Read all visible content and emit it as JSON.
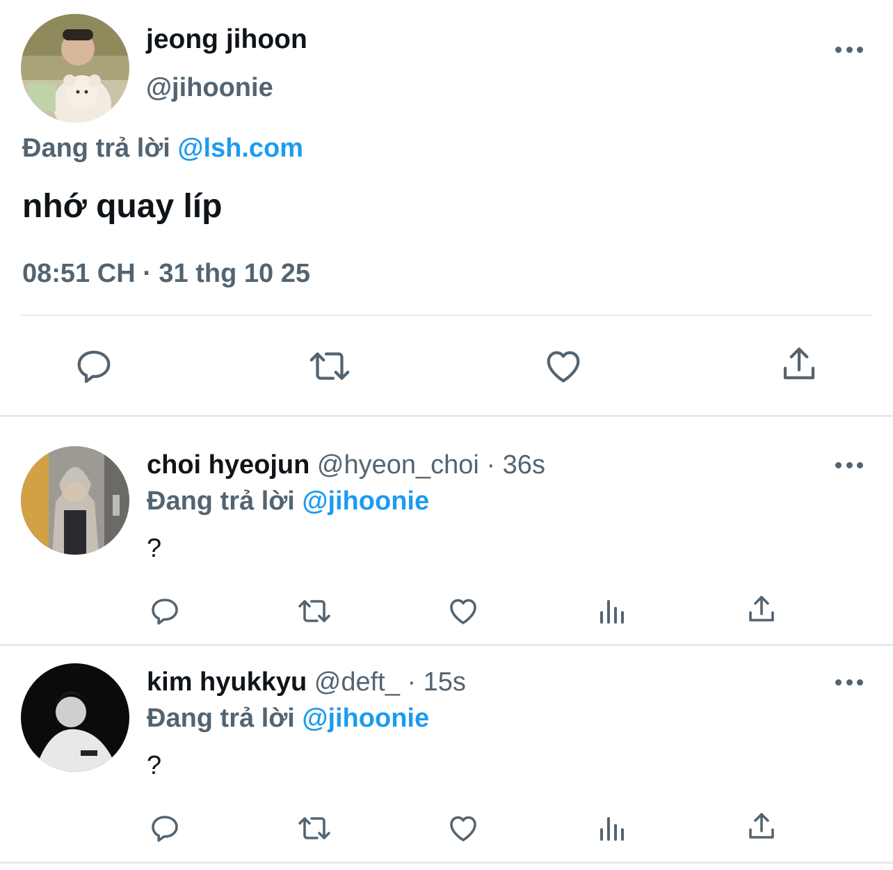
{
  "main_tweet": {
    "display_name": "jeong jihoon",
    "handle": "@jihoonie",
    "replying_prefix": "Đang trả lời",
    "replying_to": "@lsh.com",
    "text": "nhớ quay líp",
    "timestamp": "08:51 CH · 31 thg 10 25",
    "actions": [
      "reply-icon",
      "retweet-icon",
      "like-icon",
      "share-icon"
    ]
  },
  "replies": [
    {
      "display_name": "choi hyeojun",
      "handle": "@hyeon_choi",
      "sep": "·",
      "time": "36s",
      "replying_prefix": "Đang trả lời",
      "replying_to": "@jihoonie",
      "text": "?"
    },
    {
      "display_name": "kim hyukkyu",
      "handle": "@deft_",
      "sep": "·",
      "time": "15s",
      "replying_prefix": "Đang trả lời",
      "replying_to": "@jihoonie",
      "text": "?"
    }
  ],
  "colors": {
    "primary_text": "#0f1419",
    "secondary_text": "#536471",
    "accent": "#1d9bf0",
    "divider": "#e7e9ea"
  }
}
